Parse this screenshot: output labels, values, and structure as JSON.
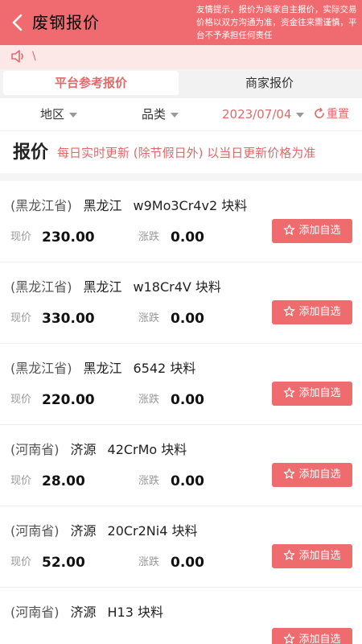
{
  "header": {
    "title": "废钢报价",
    "notice": "友情提示，报价为商家自主报价，实际交易价格以双方沟通为准，资金往来需谨慎，平台不予承担任何责任"
  },
  "marquee": {
    "text": "\\"
  },
  "tabs": [
    {
      "label": "平台参考报价",
      "active": true
    },
    {
      "label": "商家报价",
      "active": false
    }
  ],
  "filters": {
    "region": "地区",
    "category": "品类",
    "date": "2023/07/04",
    "reset": "重置"
  },
  "price_header": {
    "title": "报价",
    "description": "每日实时更新 (除节假日外) 以当日更新价格为准"
  },
  "labels": {
    "price": "现价",
    "change": "涨跌",
    "add_button": "添加自选"
  },
  "items": [
    {
      "province": "(黑龙江省)",
      "city": "黑龙江",
      "product": "w9Mo3Cr4v2 块料",
      "price": "230.00",
      "change": "0.00"
    },
    {
      "province": "(黑龙江省)",
      "city": "黑龙江",
      "product": "w18Cr4V 块料",
      "price": "330.00",
      "change": "0.00"
    },
    {
      "province": "(黑龙江省)",
      "city": "黑龙江",
      "product": "6542 块料",
      "price": "220.00",
      "change": "0.00"
    },
    {
      "province": "(河南省)",
      "city": "济源",
      "product": "42CrMo 块料",
      "price": "28.00",
      "change": "0.00"
    },
    {
      "province": "(河南省)",
      "city": "济源",
      "product": "20Cr2Ni4 块料",
      "price": "52.00",
      "change": "0.00"
    },
    {
      "province": "(河南省)",
      "city": "济源",
      "product": "H13 块料",
      "price": "",
      "change": ""
    }
  ],
  "colors": {
    "brand": "#f06b6f",
    "accent_text": "#e06a6a",
    "button": "#ee6b6e"
  }
}
